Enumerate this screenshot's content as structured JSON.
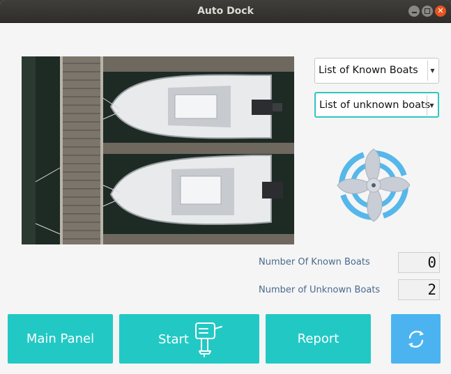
{
  "window": {
    "title": "Auto Dock"
  },
  "combos": {
    "known": "List of Known Boats",
    "unknown": "List of unknown boats"
  },
  "stats": {
    "known_label": "Number Of Known Boats",
    "known_value": "0",
    "unknown_label": "Number of Unknown Boats",
    "unknown_value": "2"
  },
  "buttons": {
    "main_panel": "Main Panel",
    "start": "Start",
    "report": "Report"
  },
  "colors": {
    "accent": "#22c9c4",
    "refresh": "#4bb4f0",
    "label": "#4a6a8f"
  },
  "icons": [
    "fan-icon",
    "outboard-motor-icon",
    "refresh-icon"
  ]
}
